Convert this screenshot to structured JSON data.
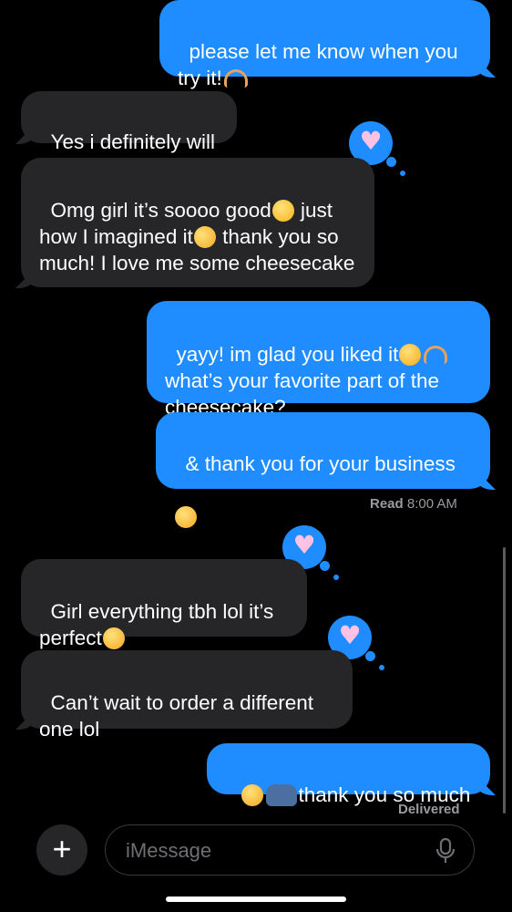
{
  "messages": [
    {
      "text_a": "please let me know when you try it!",
      "direction": "outgoing"
    },
    {
      "text_a": "Yes i definitely will",
      "direction": "incoming"
    },
    {
      "text_a": "Omg girl it’s soooo good",
      "text_b": " just how I imagined it",
      "text_c": " thank you so much! I love me some cheesecake",
      "direction": "incoming",
      "reaction": "heart"
    },
    {
      "text_a": "yayy! im glad you liked it",
      "text_b": " what’s your favorite part of the cheesecake?",
      "direction": "outgoing"
    },
    {
      "text_a": "& thank you for your business",
      "direction": "outgoing"
    },
    {
      "text_a": "Girl everything tbh lol it’s perfect",
      "direction": "incoming",
      "reaction": "heart"
    },
    {
      "text_a": "Can’t wait to order a different one lol",
      "direction": "incoming",
      "reaction": "heart"
    },
    {
      "text_a": "thank you so much",
      "direction": "outgoing"
    }
  ],
  "read_receipt": {
    "label": "Read",
    "time": "8:00 AM"
  },
  "delivered_label": "Delivered",
  "composer": {
    "placeholder": "iMessage",
    "plus_label": "+"
  },
  "colors": {
    "outgoing": "#1f8cff",
    "incoming": "#262628",
    "background": "#000000"
  },
  "icons": {
    "reaction": "heart-reaction-icon",
    "plus": "plus-icon",
    "mic": "microphone-icon"
  }
}
